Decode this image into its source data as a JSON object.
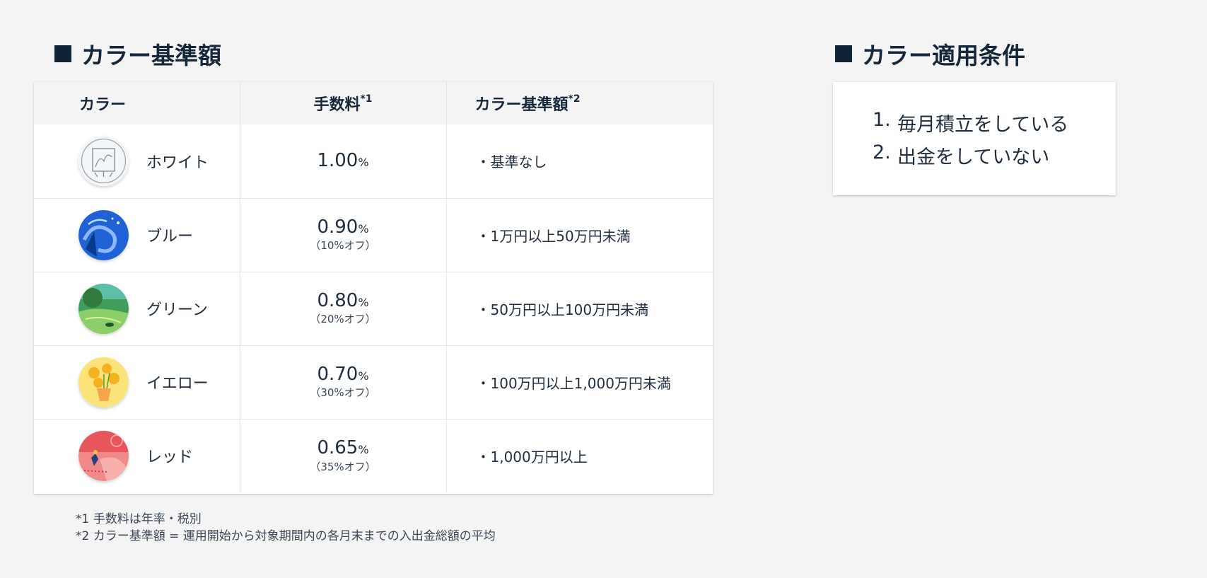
{
  "left_title": "カラー基準額",
  "right_title": "カラー適用条件",
  "table": {
    "headers": {
      "color": "カラー",
      "fee": "手数料",
      "fee_note": "*1",
      "base": "カラー基準額",
      "base_note": "*2"
    },
    "rows": [
      {
        "name": "ホワイト",
        "icon": "white-badge-icon",
        "fee": "1.00",
        "fee_unit": "%",
        "discount": "",
        "base": "・基準なし"
      },
      {
        "name": "ブルー",
        "icon": "blue-badge-icon",
        "fee": "0.90",
        "fee_unit": "%",
        "discount": "（10%オフ）",
        "base": "・1万円以上50万円未満"
      },
      {
        "name": "グリーン",
        "icon": "green-badge-icon",
        "fee": "0.80",
        "fee_unit": "%",
        "discount": "（20%オフ）",
        "base": "・50万円以上100万円未満"
      },
      {
        "name": "イエロー",
        "icon": "yellow-badge-icon",
        "fee": "0.70",
        "fee_unit": "%",
        "discount": "（30%オフ）",
        "base": "・100万円以上1,000万円未満"
      },
      {
        "name": "レッド",
        "icon": "red-badge-icon",
        "fee": "0.65",
        "fee_unit": "%",
        "discount": "（35%オフ）",
        "base": "・1,000万円以上"
      }
    ]
  },
  "conditions": [
    {
      "num": "1.",
      "text": "毎月積立をしている"
    },
    {
      "num": "2.",
      "text": "出金をしていない"
    }
  ],
  "footnotes": [
    "*1 手数料は年率・税別",
    "*2 カラー基準額 = 運用開始から対象期間内の各月末までの入出金総額の平均"
  ],
  "colors": {
    "title": "#16273a",
    "text": "#1f2d3d",
    "background": "#f4f4f4",
    "white": "#eef1f3",
    "blue": "#1e62d6",
    "green": "#3f9c5a",
    "yellow": "#f5cf3a",
    "red": "#e8555a"
  }
}
